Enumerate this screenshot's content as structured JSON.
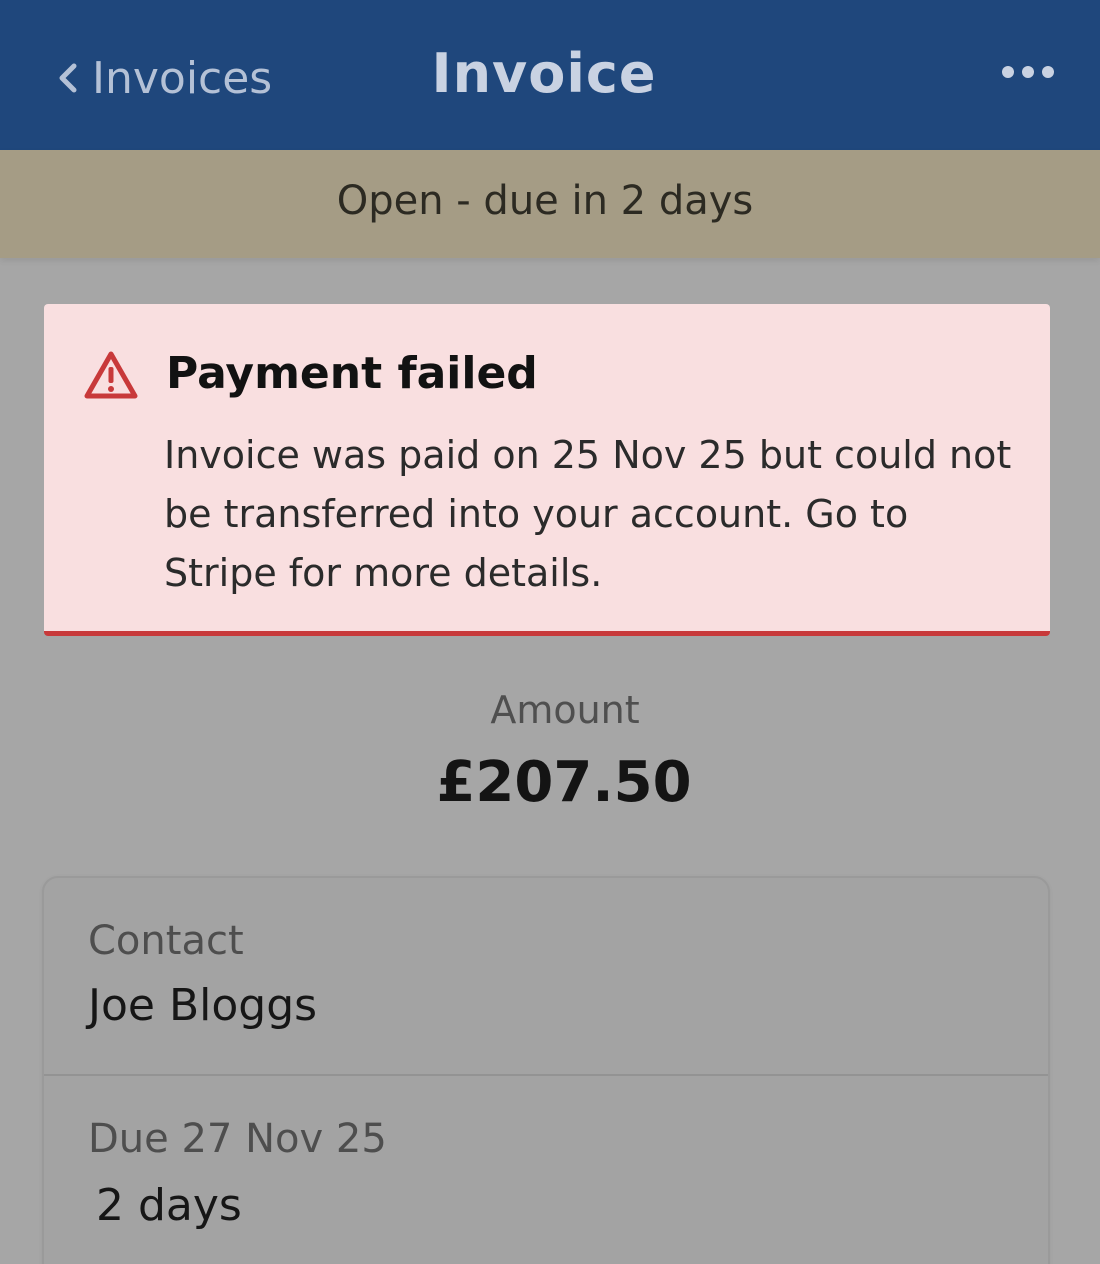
{
  "header": {
    "back_label": "Invoices",
    "title": "Invoice"
  },
  "status": {
    "text": "Open - due in 2 days"
  },
  "alert": {
    "title": "Payment failed",
    "body": "Invoice was paid on 25 Nov 25 but could not be transferred into your account. Go to Stripe for more details."
  },
  "amount": {
    "label": "Amount",
    "value": "£207.50"
  },
  "details": {
    "contact_label": "Contact",
    "contact_name": "Joe Bloggs",
    "due_label": "Due 27 Nov 25",
    "due_value": "2 days"
  },
  "colors": {
    "header_bg": "#1f477c",
    "status_bg": "#a59c85",
    "alert_bg": "#f9dfe0",
    "alert_accent": "#c8393a"
  },
  "icons": {
    "back": "chevron-left-icon",
    "more": "ellipsis-icon",
    "warning": "warning-triangle-icon"
  }
}
